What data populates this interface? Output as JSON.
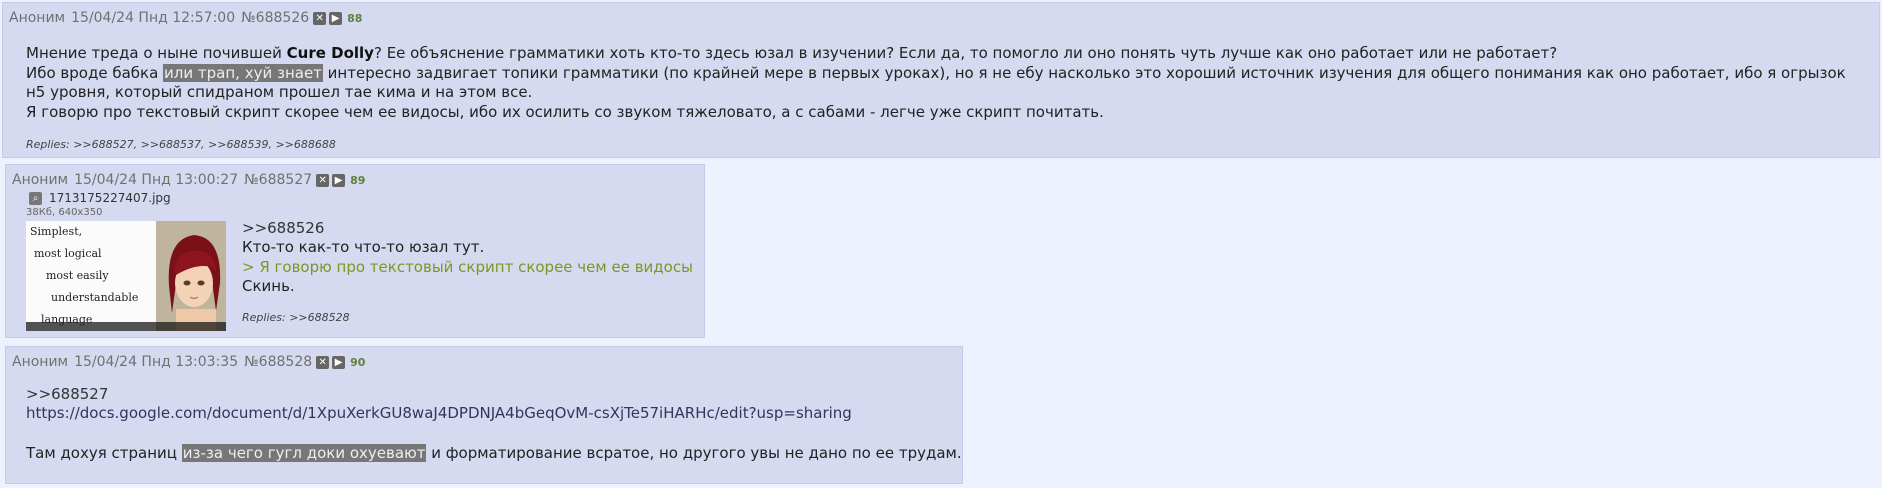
{
  "posts": [
    {
      "name": "Аноним",
      "datetime": "15/04/24 Пнд 12:57:00",
      "number": "№688526",
      "count": "88",
      "text": {
        "l1_a": "Мнение треда о ныне почившей ",
        "l1_bold": "Cure Dolly",
        "l1_b": "? Ее объяснение грамматики хоть кто-то здесь юзал в изучении? Если да, то помогло ли оно понять чуть лучше как оно работает или не работает?",
        "l2_a": "Ибо вроде бабка ",
        "l2_spoiler": "или трап, хуй знает",
        "l2_b": " интересно задвигает топики грамматики (по крайней мере в первых уроках), но я не ебу насколько это хороший источник изучения для общего понимания как оно работает, ибо я огрызок н5 уровня, который спидраном прошел тае кима и на этом все.",
        "l3": "Я говорю про текстовый скрипт скорее чем ее видосы, ибо их осилить со звуком тяжеловато, а с сабами - легче уже скрипт почитать."
      },
      "replies": "Replies: >>688527, >>688537, >>688539, >>688688"
    },
    {
      "name": "Аноним",
      "datetime": "15/04/24 Пнд 13:00:27",
      "number": "№688527",
      "count": "89",
      "file_name": "1713175227407.jpg",
      "file_meta": "38Кб, 640x350",
      "thumb_lines": [
        "Simplest,",
        "most logical",
        "most easily",
        "understandable",
        "language"
      ],
      "quote": ">>688526",
      "line1": "Кто-то как-то что-то юзал тут.",
      "greentext": "> Я говорю про текстовый скрипт скорее чем ее видосы",
      "line2": "Скинь.",
      "replies": "Replies: >>688528"
    },
    {
      "name": "Аноним",
      "datetime": "15/04/24 Пнд 13:03:35",
      "number": "№688528",
      "count": "90",
      "quote": ">>688527",
      "link": "https://docs.google.com/document/d/1XpuXerkGU8waJ4DPDNJA4bGeqOvM-csXjTe57iHARHc/edit?usp=sharing",
      "l_a": "Там дохуя страниц ",
      "l_spoiler": "из-за чего гугл доки охуевают",
      "l_b": " и форматирование всратое, но другого увы не дано по ее трудам."
    }
  ],
  "icons": {
    "hide": "close-square-icon",
    "play": "play-icon",
    "search": "magnifier-icon"
  },
  "colors": {
    "page_bg": "#eef2ff",
    "post_bg": "#d6daf0",
    "greentext": "#789922",
    "count": "#5f7f3f"
  }
}
